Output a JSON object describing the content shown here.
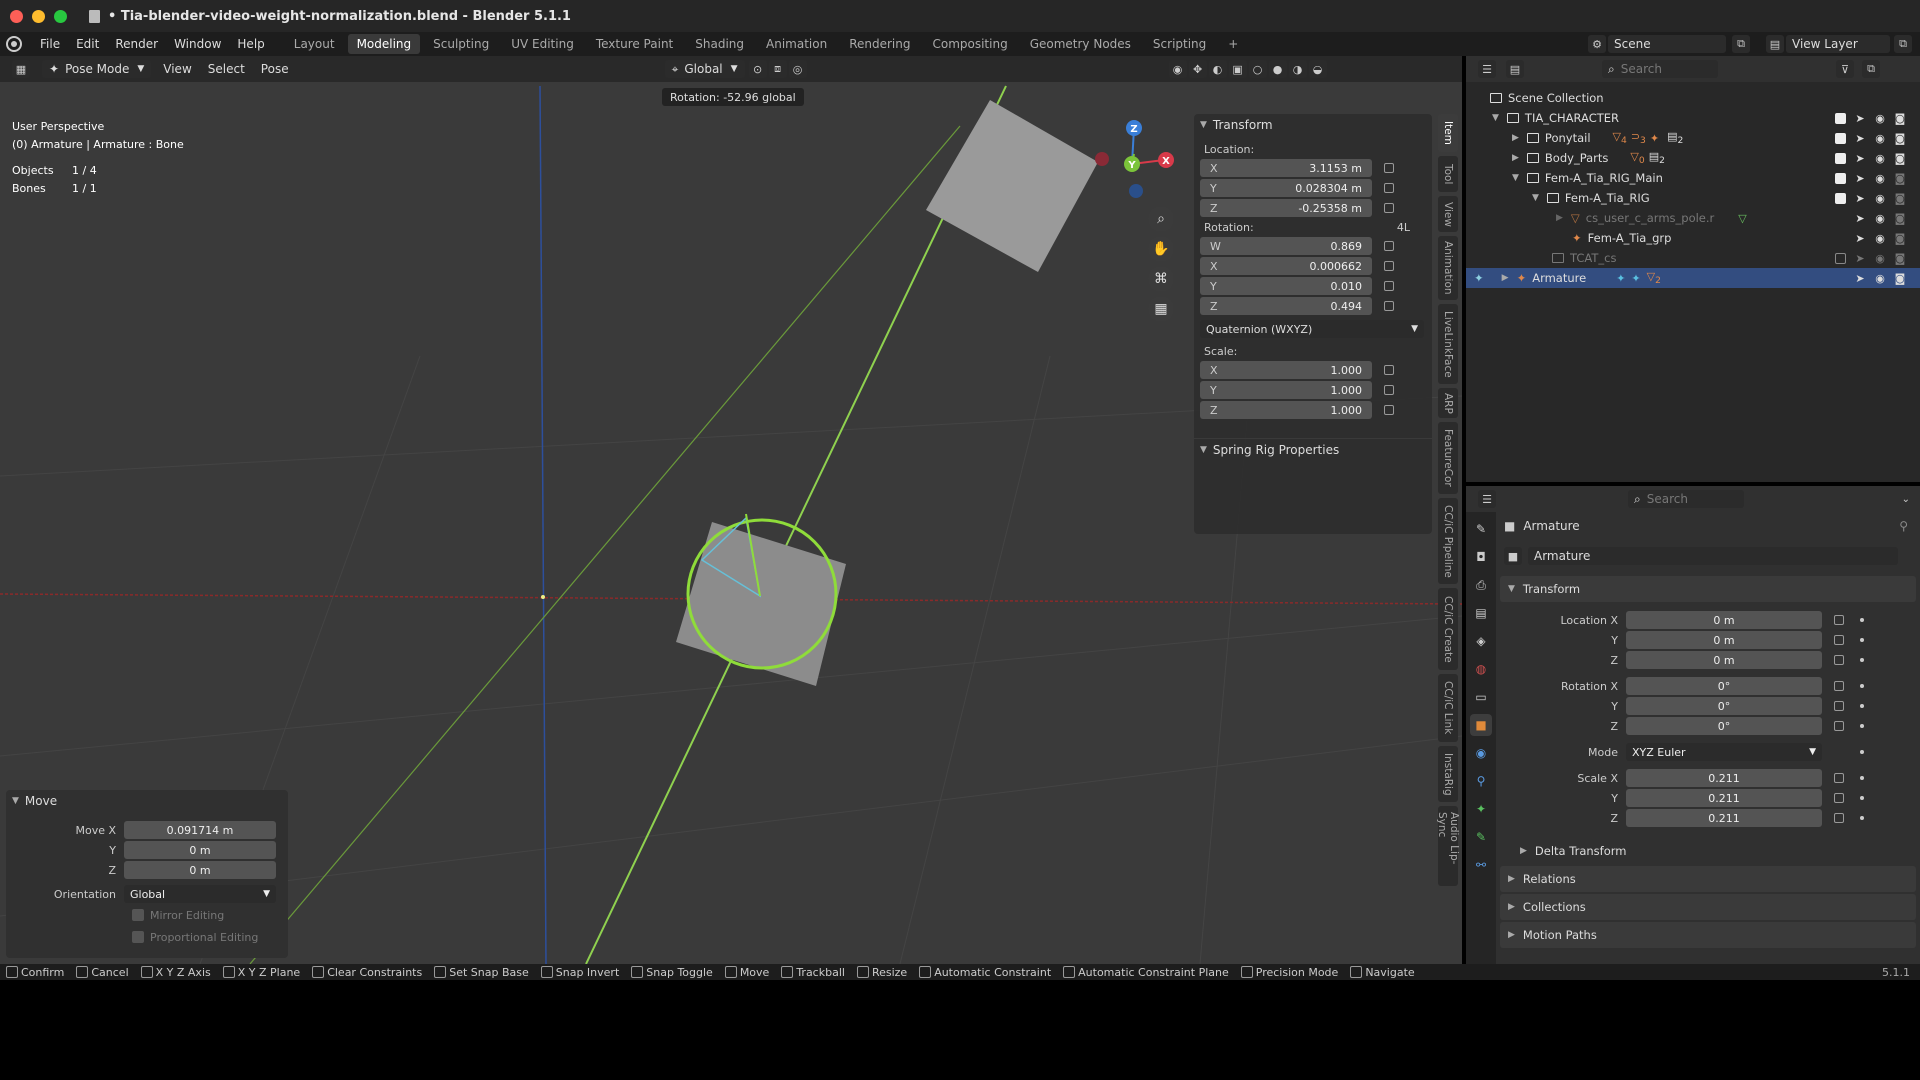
{
  "window": {
    "title": "• Tia-blender-video-weight-normalization.blend - Blender 5.1.1"
  },
  "menubar": {
    "items": [
      "File",
      "Edit",
      "Render",
      "Window",
      "Help"
    ],
    "workspaces": [
      "Layout",
      "Modeling",
      "Sculpting",
      "UV Editing",
      "Texture Paint",
      "Shading",
      "Animation",
      "Rendering",
      "Compositing",
      "Geometry Nodes",
      "Scripting"
    ],
    "active_workspace": "Modeling",
    "scene": "Scene",
    "view_layer": "View Layer"
  },
  "viewport": {
    "mode": "Pose Mode",
    "menus": [
      "View",
      "Select",
      "Pose"
    ],
    "orientation": "Global",
    "overlay_title": "User Perspective",
    "overlay_context": "(0) Armature | Armature : Bone",
    "stats": [
      {
        "label": "Objects",
        "value": "1 / 4"
      },
      {
        "label": "Bones",
        "value": "1 / 1"
      }
    ],
    "rotation_tip": "Rotation: -52.96 global",
    "gizmo_axes": {
      "z": "Z",
      "y": "Y",
      "x": "X"
    }
  },
  "npanel": {
    "transform_title": "Transform",
    "location_label": "Location:",
    "location": [
      {
        "axis": "X",
        "value": "3.1153 m"
      },
      {
        "axis": "Y",
        "value": "0.028304 m"
      },
      {
        "axis": "Z",
        "value": "-0.25358 m"
      }
    ],
    "rotation_label": "Rotation:",
    "rotation_flag": "4L",
    "rotation": [
      {
        "axis": "W",
        "value": "0.869"
      },
      {
        "axis": "X",
        "value": "0.000662"
      },
      {
        "axis": "Y",
        "value": "0.010"
      },
      {
        "axis": "Z",
        "value": "0.494"
      }
    ],
    "rotation_mode": "Quaternion (WXYZ)",
    "scale_label": "Scale:",
    "scale": [
      {
        "axis": "X",
        "value": "1.000"
      },
      {
        "axis": "Y",
        "value": "1.000"
      },
      {
        "axis": "Z",
        "value": "1.000"
      }
    ],
    "spring_title": "Spring Rig Properties"
  },
  "sidetabs": [
    "Item",
    "Tool",
    "View",
    "Animation",
    "LiveLinkFace",
    "ARP",
    "FeatureCor",
    "CC/iC Pipeline",
    "CC/iC Create",
    "CC/iC Link",
    "InstaRig",
    "Audio Lip-Sync"
  ],
  "operator": {
    "title": "Move",
    "fields": [
      {
        "label": "Move X",
        "value": "0.091714 m"
      },
      {
        "label": "Y",
        "value": "0 m"
      },
      {
        "label": "Z",
        "value": "0 m"
      }
    ],
    "orientation_label": "Orientation",
    "orientation_value": "Global",
    "mirror": "Mirror Editing",
    "proportional": "Proportional Editing"
  },
  "outliner": {
    "search_placeholder": "Search",
    "root": "Scene Collection",
    "rows": [
      {
        "name": "TIA_CHARACTER",
        "indent": 0
      },
      {
        "name": "Ponytail",
        "indent": 1
      },
      {
        "name": "Body_Parts",
        "indent": 1
      },
      {
        "name": "Fem-A_Tia_RIG_Main",
        "indent": 1
      },
      {
        "name": "Fem-A_Tia_RIG",
        "indent": 2
      },
      {
        "name": "cs_user_c_arms_pole.r",
        "indent": 3
      },
      {
        "name": "Fem-A_Tia_grp",
        "indent": 3
      },
      {
        "name": "TCAT_cs",
        "indent": 2
      },
      {
        "name": "Armature",
        "indent": 0
      }
    ],
    "badges": {
      "ponytail_a": "4",
      "ponytail_b": "3",
      "ponytail_c": "2",
      "body_a": "0",
      "body_b": "2",
      "armature_a": "2"
    }
  },
  "properties": {
    "search_placeholder": "Search",
    "object_name": "Armature",
    "data_name": "Armature",
    "transform_title": "Transform",
    "location": [
      {
        "label": "Location X",
        "value": "0 m"
      },
      {
        "label": "Y",
        "value": "0 m"
      },
      {
        "label": "Z",
        "value": "0 m"
      }
    ],
    "rotation": [
      {
        "label": "Rotation X",
        "value": "0°"
      },
      {
        "label": "Y",
        "value": "0°"
      },
      {
        "label": "Z",
        "value": "0°"
      }
    ],
    "mode_label": "Mode",
    "mode_value": "XYZ Euler",
    "scale": [
      {
        "label": "Scale X",
        "value": "0.211"
      },
      {
        "label": "Y",
        "value": "0.211"
      },
      {
        "label": "Z",
        "value": "0.211"
      }
    ],
    "sections": [
      "Delta Transform",
      "Relations",
      "Collections",
      "Motion Paths"
    ]
  },
  "statusbar": {
    "items": [
      "Confirm",
      "Cancel",
      "X Y Z Axis",
      "X Y Z Plane",
      "Clear Constraints",
      "Set Snap Base",
      "Snap Invert",
      "Snap Toggle",
      "Move",
      "Trackball",
      "Resize",
      "Automatic Constraint",
      "Automatic Constraint Plane",
      "Precision Mode",
      "Navigate"
    ],
    "version": "5.1.1"
  }
}
